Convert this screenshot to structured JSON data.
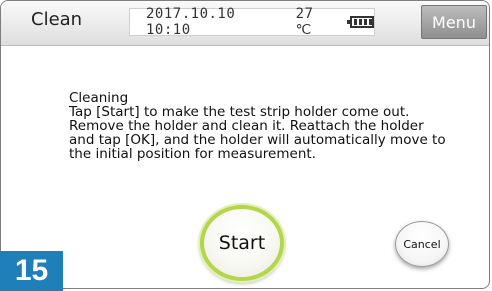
{
  "header": {
    "title": "Clean",
    "datetime": "2017.10.10 10:10",
    "temperature": "27 ℃",
    "battery_icon": "battery-icon",
    "menu_label": "Menu"
  },
  "message": {
    "heading": "Cleaning",
    "lines": [
      "Tap [Start] to make the test strip holder come out.",
      "Remove the holder and clean it. Reattach the holder",
      "and tap [OK], and the holder will automatically move to",
      "the initial position for measurement."
    ]
  },
  "buttons": {
    "start_label": "Start",
    "cancel_label": "Cancel"
  },
  "step_number": "15"
}
